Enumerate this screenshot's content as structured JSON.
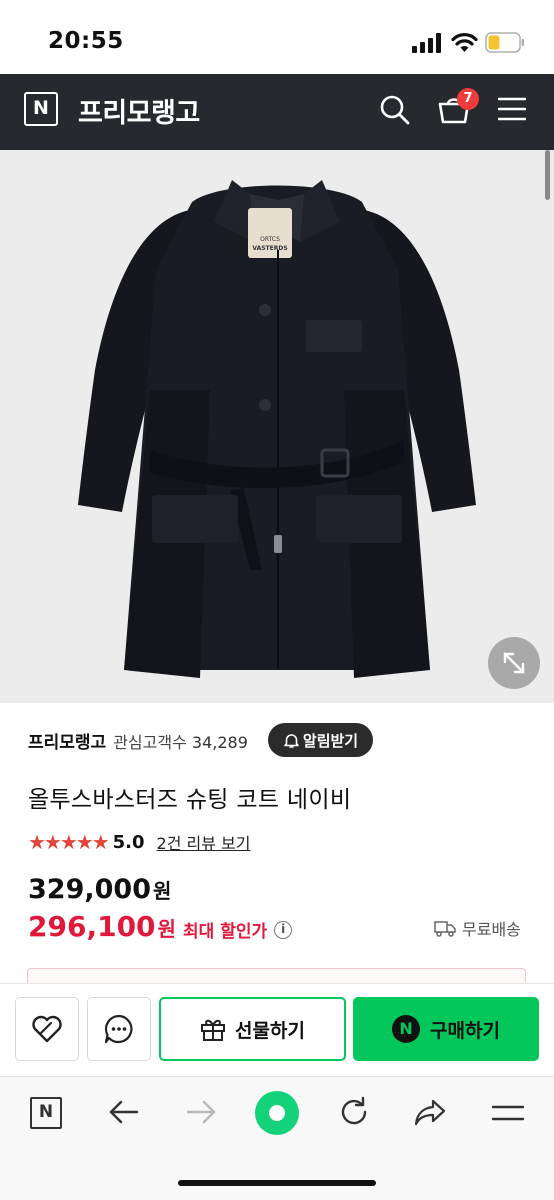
{
  "status_bar": {
    "time": "20:55"
  },
  "header": {
    "logo": "N",
    "store_name": "프리모랭고",
    "cart_count": "7"
  },
  "product": {
    "coat_label_top": "ORTCS",
    "coat_label_sub": "VASTERDS",
    "store_name": "프리모랭고",
    "fans_label": "관심고객수",
    "fans_count": "34,289",
    "alarm_label": "알림받기",
    "title": "올투스바스터즈 슈팅 코트 네이비",
    "stars": "★★★★★",
    "rating": "5.0",
    "review_link": "2건 리뷰 보기",
    "price_original": "329,000",
    "price_sale": "296,100",
    "price_unit": "원",
    "max_discount_label": "최대 할인가",
    "info_icon": "i",
    "shipping_label": "무료배송"
  },
  "actions": {
    "gift_label": "선물하기",
    "buy_label": "구매하기",
    "npay_logo": "N"
  },
  "browser": {
    "home_logo": "N"
  },
  "colors": {
    "header_bg": "#262a2e",
    "naver_green": "#03c75a",
    "sale_red": "#e0193a",
    "star_red": "#e0463a",
    "badge_red": "#ef3b3b"
  },
  "icons": [
    "signal-icon",
    "wifi-icon",
    "battery-icon",
    "search-icon",
    "cart-icon",
    "menu-icon",
    "expand-icon",
    "heart-icon",
    "chat-icon",
    "gift-icon",
    "truck-icon",
    "bell-icon",
    "back-icon",
    "forward-icon",
    "refresh-icon",
    "share-icon"
  ]
}
